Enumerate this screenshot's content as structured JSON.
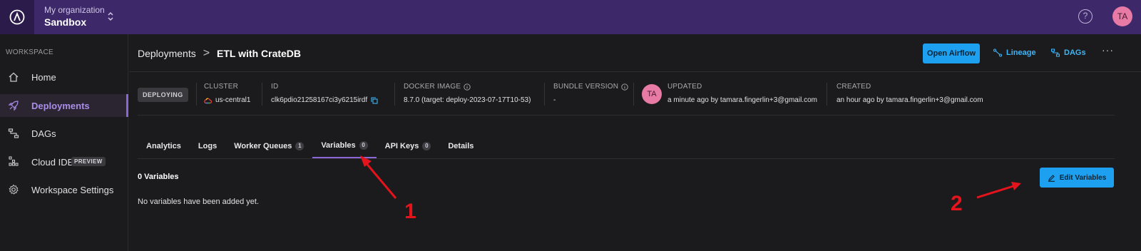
{
  "topbar": {
    "org_label": "My organization",
    "org_name": "Sandbox",
    "help_glyph": "?",
    "user_initials": "TA"
  },
  "sidebar": {
    "section_label": "WORKSPACE",
    "items": [
      {
        "label": "Home",
        "icon": "home-icon"
      },
      {
        "label": "Deployments",
        "icon": "rocket-icon",
        "active": true
      },
      {
        "label": "DAGs",
        "icon": "dags-icon"
      },
      {
        "label": "Cloud IDE",
        "icon": "cloud-ide-icon",
        "badge": "PREVIEW"
      },
      {
        "label": "Workspace Settings",
        "icon": "gear-icon"
      }
    ]
  },
  "breadcrumb": {
    "parent": "Deployments",
    "separator": ">",
    "current": "ETL with CrateDB"
  },
  "header_actions": {
    "open_airflow": "Open Airflow",
    "lineage": "Lineage",
    "dags": "DAGs",
    "more": "···"
  },
  "deployment": {
    "status": "DEPLOYING",
    "cluster_title": "CLUSTER",
    "cluster_value": "us-central1",
    "id_title": "ID",
    "id_value": "clk6pdio21258167ci3y6215irdf",
    "docker_title": "DOCKER IMAGE",
    "docker_value": "8.7.0 (target: deploy-2023-07-17T10-53)",
    "bundle_title": "BUNDLE VERSION",
    "bundle_value": "-",
    "updated_title": "UPDATED",
    "updated_initials": "TA",
    "updated_value": "a minute ago by tamara.fingerlin+3@gmail.com",
    "created_title": "CREATED",
    "created_value": "an hour ago by tamara.fingerlin+3@gmail.com"
  },
  "tabs": [
    {
      "label": "Analytics"
    },
    {
      "label": "Logs"
    },
    {
      "label": "Worker Queues",
      "count": "1"
    },
    {
      "label": "Variables",
      "count": "0",
      "active": true
    },
    {
      "label": "API Keys",
      "count": "0"
    },
    {
      "label": "Details"
    }
  ],
  "variables": {
    "count_label": "0 Variables",
    "empty_message": "No variables have been added yet.",
    "edit_button": "Edit Variables"
  },
  "annotations": {
    "marker_1": "1",
    "marker_2": "2",
    "color": "#e5131b"
  },
  "colors": {
    "topbar": "#3d2869",
    "accent_purple": "#8a66d6",
    "primary_button": "#1ea0f0",
    "link_blue": "#3fb4f5",
    "background": "#1b1b1d"
  }
}
